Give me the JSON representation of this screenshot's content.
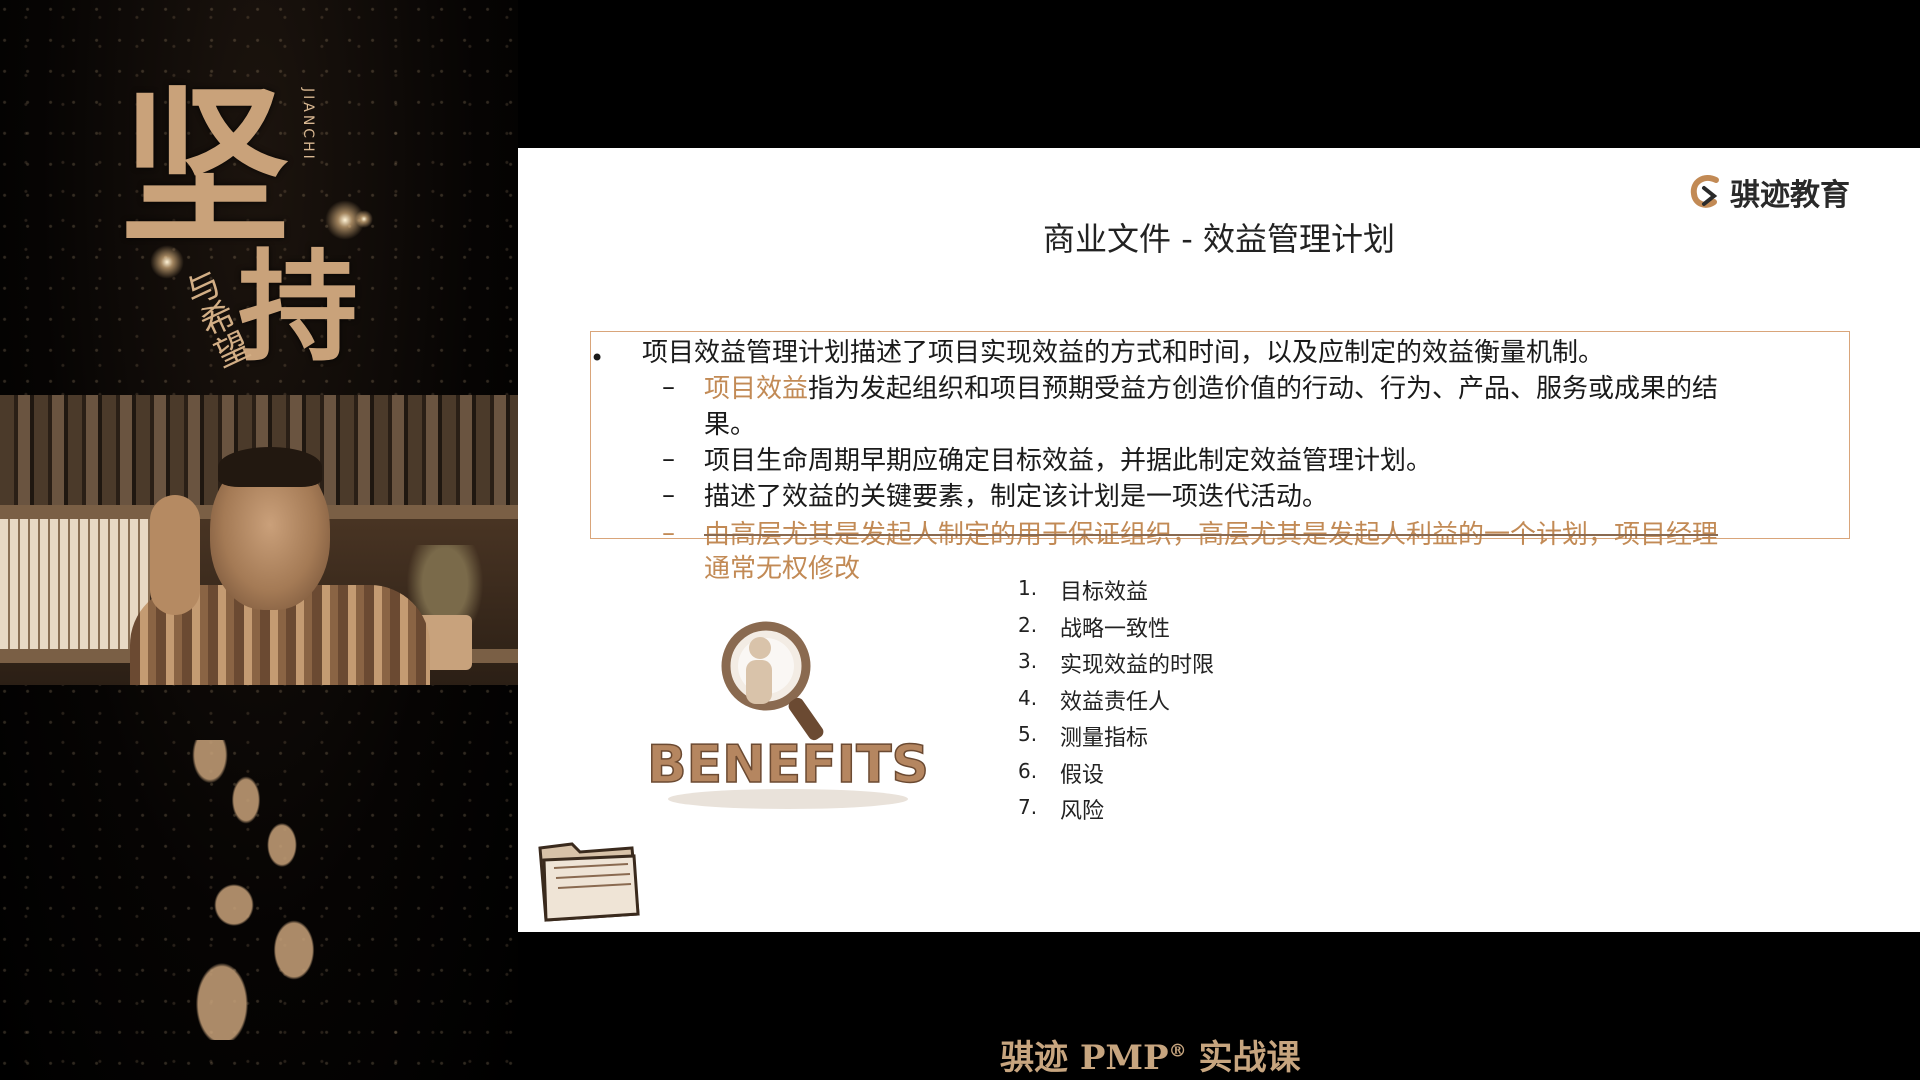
{
  "poster": {
    "main_chars": [
      "坚",
      "持"
    ],
    "pinyin": "JIANCHI",
    "subtitle": "与希望"
  },
  "slide": {
    "logo_text": "骐迹教育",
    "title": "商业文件 - 效益管理计划",
    "main_bullet": "项目效益管理计划描述了项目实现效益的方式和时间，以及应制定的效益衡量机制。",
    "sub_bullets": {
      "b1_highlight": "项目效益",
      "b1_rest_line1": "指为发起组织和项目预期受益方创造价值的行动、行为、产品、服务或成果的结",
      "b1_line2": "果。",
      "b2": "项目生命周期早期应确定目标效益，并据此制定效益管理计划。",
      "b3": "描述了效益的关键要素，制定该计划是一项迭代活动。",
      "b4_line1": "由高层尤其是发起人制定的用于保证组织，高层尤其是发起人利益的一个计划，项目经理",
      "b4_line2": "通常无权修改"
    },
    "dash_symbol": "–",
    "bullet_symbol": "•",
    "elements": [
      {
        "num": "1.",
        "text": "目标效益"
      },
      {
        "num": "2.",
        "text": "战略一致性"
      },
      {
        "num": "3.",
        "text": "实现效益的时限"
      },
      {
        "num": "4.",
        "text": "效益责任人"
      },
      {
        "num": "5.",
        "text": "测量指标"
      },
      {
        "num": "6.",
        "text": "假设"
      },
      {
        "num": "7.",
        "text": "风险"
      }
    ],
    "benefits_image_text": "BENEFITS"
  },
  "footer": {
    "caption_pre": "骐迹 PMP",
    "caption_reg": "®",
    "caption_post": " 实战课"
  },
  "colors": {
    "accent": "#c28a55",
    "box_border": "#d9a57a",
    "poster_gold": "#c9a27a"
  }
}
